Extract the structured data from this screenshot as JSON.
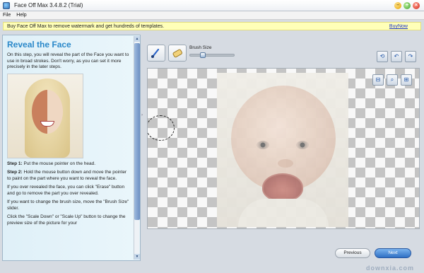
{
  "window": {
    "title": "Face Off Max  3.4.8.2  (Trial)",
    "controls": {
      "minimize": "–",
      "maximize": "+",
      "close": "×"
    }
  },
  "menu": [
    "File",
    "Help"
  ],
  "notice": {
    "text": "Buy Face Off Max to remove watermark and get hundreds of templates.",
    "link": "BuyNow"
  },
  "left_panel": {
    "title": "Reveal the Face",
    "intro": "On this step, you will reveal the part of the Face you want to use in broad strokes. Don't worry, as you can set it more precisely in the later steps.",
    "steps": [
      {
        "prefix": "Step 1:",
        "text": " Put the mouse pointer on the head."
      },
      {
        "prefix": "Step 2:",
        "text": " Hold the mouse button down and move the pointer to paint on the part where you want to reveal the face."
      }
    ],
    "para_erase": "If you over revealed the face, you can click \"Erase\" button and go to remove the part you over revealed.",
    "para_brush": "If you want to change the brush size, move the \"Brush Size\" slider.",
    "para_scale": "Click the \"Scale Down\" or \"Scale Up\" button to change the preview size of the picture for your"
  },
  "toolbar": {
    "brush_size_label": "Brush Size",
    "brush_size_value_fraction": 0.25
  },
  "top_right_icons": [
    "reset-icon",
    "undo-icon",
    "redo-icon"
  ],
  "view_icons": [
    "zoom-out-icon",
    "zoom-fit-icon",
    "zoom-in-icon"
  ],
  "buttons": {
    "previous": "Previous",
    "next": "Next"
  },
  "watermark": {
    "main": "downxia",
    "suffix": ".com"
  }
}
